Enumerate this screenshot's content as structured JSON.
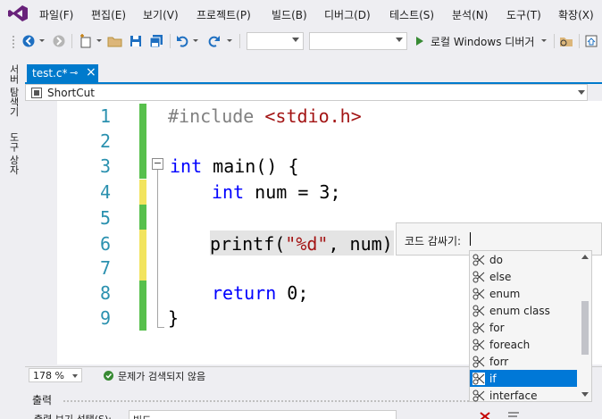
{
  "menu": [
    "파일(F)",
    "편집(E)",
    "보기(V)",
    "프로젝트(P)",
    "빌드(B)",
    "디버그(D)",
    "테스트(S)",
    "분석(N)",
    "도구(T)",
    "확장(X)"
  ],
  "toolbar": {
    "run_label": "로컬 Windows 디버거"
  },
  "left_dock": {
    "server_explorer": "서버 탐색기",
    "toolbox": "도구 상자"
  },
  "tab": {
    "title": "test.c*",
    "pin": "⊸",
    "close": "×"
  },
  "navbar": {
    "scope": "ShortCut"
  },
  "editor": {
    "line_numbers": [
      "1",
      "2",
      "3",
      "4",
      "5",
      "6",
      "7",
      "8",
      "9"
    ],
    "lines": {
      "l1_pp": "#include ",
      "l1_hdr": "<stdio.h>",
      "l3_kw": "int",
      "l3_rest": " main() {",
      "l4_kw": "int",
      "l4_rest": " num = 3;",
      "l6_fn": "printf(",
      "l6_str": "\"%d\"",
      "l6_rest": ", num);",
      "l8_kw": "return",
      "l8_rest": " 0;",
      "l9": "}"
    },
    "collapse": "−"
  },
  "status": {
    "zoom": "178 %",
    "issues": "문제가 검색되지 않음"
  },
  "output": {
    "title": "출력",
    "show_output_from": "출력 보기 선택(S):",
    "source": "빌드"
  },
  "snippet": {
    "prompt": "코드 감싸기:",
    "items": [
      "do",
      "else",
      "enum",
      "enum class",
      "for",
      "foreach",
      "forr",
      "if",
      "interface"
    ],
    "selected": "if"
  }
}
